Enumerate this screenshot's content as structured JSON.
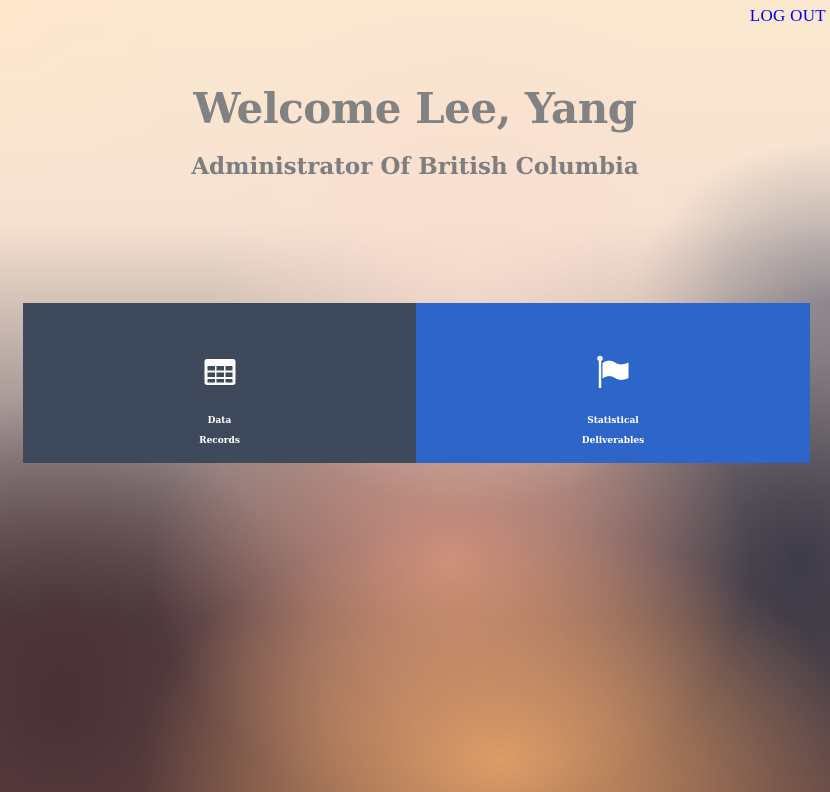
{
  "header": {
    "logout_label": "LOG OUT",
    "welcome": "Welcome Lee, Yang",
    "role": "Administrator Of British Columbia"
  },
  "tiles": [
    {
      "line1": "Data",
      "line2": "Records",
      "icon": "table-icon",
      "color": "#3e4a5b"
    },
    {
      "line1": "Statistical",
      "line2": "Deliverables",
      "icon": "flag-icon",
      "color": "#2e65c9"
    }
  ],
  "colors": {
    "logout_link": "#0000ee",
    "heading_text": "#828282"
  }
}
